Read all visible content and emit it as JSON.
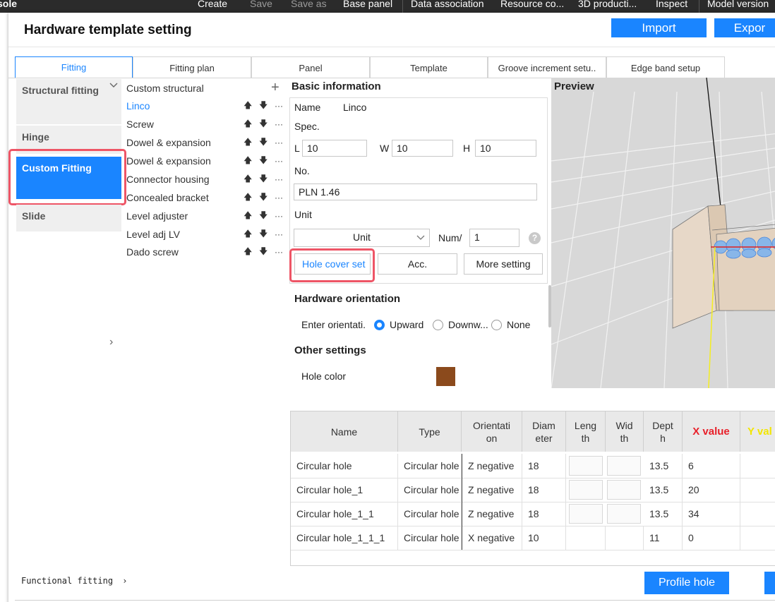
{
  "topbar": {
    "items": [
      "sole",
      "Create",
      "Save",
      "Save as",
      "Base panel",
      "Data association",
      "Resource co...",
      "3D producti...",
      "Inspect",
      "Model version"
    ]
  },
  "dialog": {
    "title": "Hardware template setting",
    "import_label": "Import",
    "export_label": "Expor"
  },
  "tabs": [
    "Fitting",
    "Fitting plan",
    "Panel",
    "Template",
    "Groove increment setu..",
    "Edge band setup"
  ],
  "categories": [
    "Structural fitting",
    "Hinge",
    "Custom Fitting",
    "Slide"
  ],
  "fitting_list": {
    "header": "Custom structural",
    "items": [
      "Linco",
      "Screw",
      "Dowel & expansion",
      "Dowel & expansion",
      "Connector housing",
      "Concealed bracket",
      "Level adjuster",
      "Level adj LV",
      "Dado screw"
    ]
  },
  "basic_info": {
    "heading": "Basic information",
    "name_label": "Name",
    "name_value": "Linco",
    "spec_label": "Spec.",
    "l_label": "L",
    "l_value": "10",
    "w_label": "W",
    "w_value": "10",
    "h_label": "H",
    "h_value": "10",
    "no_label": "No.",
    "no_value": "PLN 1.46",
    "unit_label": "Unit",
    "unit_value": "Unit",
    "num_label": "Num/",
    "num_value": "1",
    "hole_cover_btn": "Hole cover set",
    "acc_btn": "Acc.",
    "more_btn": "More setting"
  },
  "orientation": {
    "heading": "Hardware orientation",
    "enter_label": "Enter orientati.",
    "options": [
      "Upward",
      "Downw...",
      "None"
    ],
    "selected": "Upward"
  },
  "other": {
    "heading": "Other settings",
    "hole_color_label": "Hole color",
    "hole_color": "#8b4a1c"
  },
  "preview": {
    "label": "Preview"
  },
  "table": {
    "headers": [
      "Name",
      "Type",
      "Orientati\non",
      "Diam\neter",
      "Leng\nth",
      "Wid\nth",
      "Dept\nh",
      "X value",
      "Y val"
    ],
    "rows": [
      [
        "Circular hole",
        "Circular hole",
        "Z negative",
        "18",
        "",
        "",
        "13.5",
        "6"
      ],
      [
        "Circular hole_1",
        "Circular hole",
        "Z negative",
        "18",
        "",
        "",
        "13.5",
        "20"
      ],
      [
        "Circular hole_1_1",
        "Circular hole",
        "Z negative",
        "18",
        "",
        "",
        "13.5",
        "34"
      ],
      [
        "Circular hole_1_1_1",
        "Circular hole",
        "X negative",
        "10",
        "",
        "",
        "11",
        "0"
      ]
    ]
  },
  "footer": {
    "functional_label": "Functional fitting",
    "profile_btn": "Profile hole"
  },
  "colors": {
    "accent": "#1a85ff",
    "highlight_box": "#ee5566",
    "x_value_header": "#e8202a",
    "y_value_header": "#f2e600"
  }
}
